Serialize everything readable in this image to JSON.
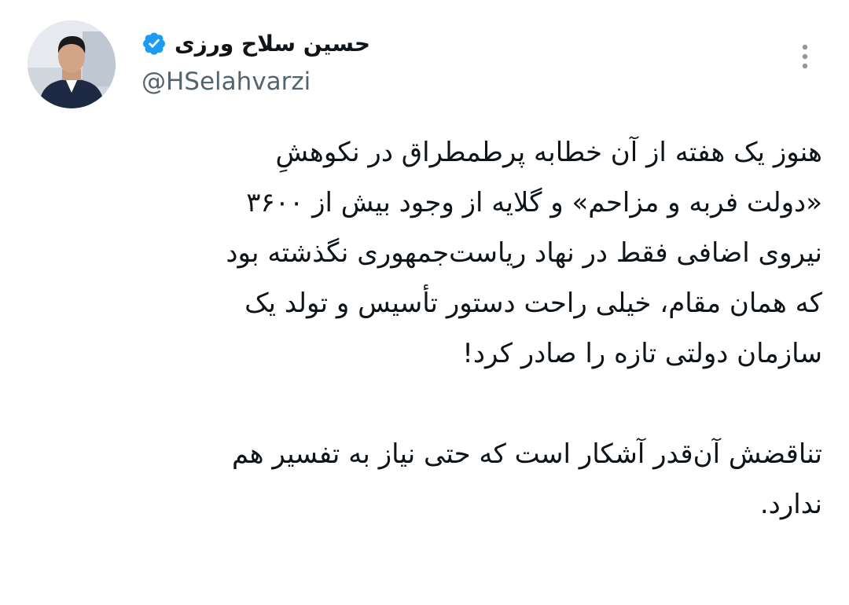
{
  "author": {
    "display_name": "حسین سلاح ورزی",
    "handle": "@HSelahvarzi",
    "verified": true,
    "verified_color": "#1d9bf0"
  },
  "icons": {
    "verified": "verified-badge-icon",
    "more": "more-vertical-icon"
  },
  "tweet": {
    "paragraph_1": {
      "line_1": "هنوز یک هفته از آن خطابه پرطمطراق در نکوهشِ",
      "line_2": "«دولت فربه و مزاحم» و گلایه از وجود بیش از ۳۶۰۰",
      "line_3": "نیروی اضافی فقط در نهاد ریاست‌جمهوری نگذشته بود",
      "line_4": "که همان مقام، خیلی راحت دستور تأسیس و تولد یک",
      "line_5": "سازمان دولتی تازه را صادر کرد!"
    },
    "paragraph_2": {
      "line_1": "تناقضش آن‌قدر آشکار است که حتی نیاز به تفسیر هم",
      "line_2": "ندارد."
    }
  }
}
